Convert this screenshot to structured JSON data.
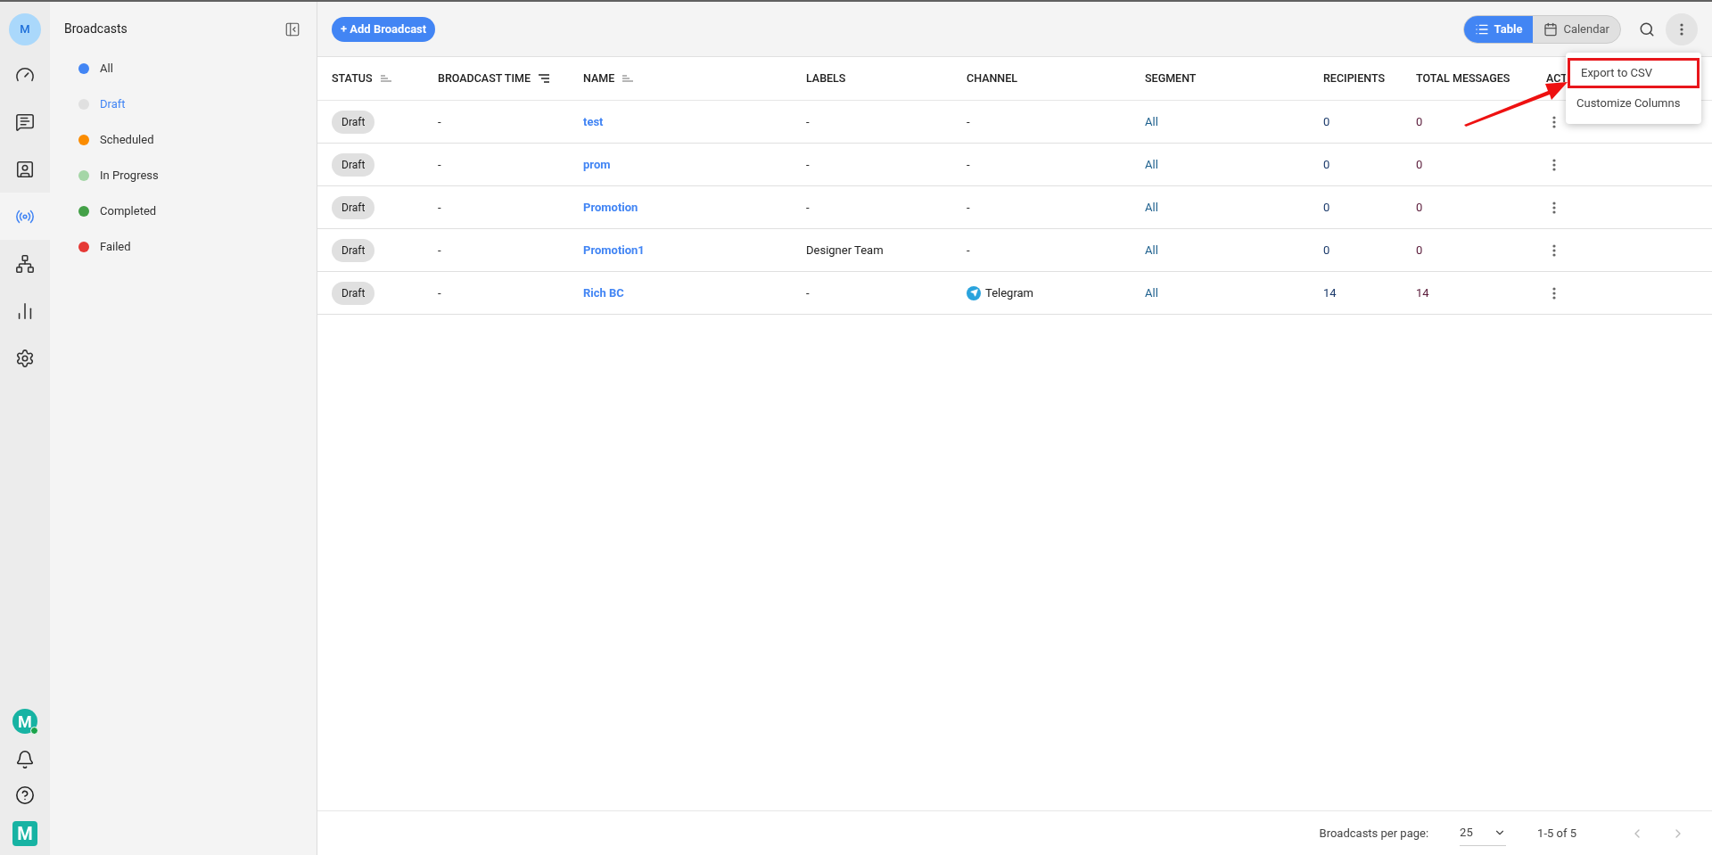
{
  "rail": {
    "avatar": "M",
    "items": [
      {
        "selected": false
      },
      {
        "selected": false
      },
      {
        "selected": false
      },
      {
        "selected": true
      },
      {
        "selected": false
      },
      {
        "selected": false
      },
      {
        "selected": false
      }
    ],
    "workspace_logo": "M",
    "brand_logo": "M"
  },
  "sidebar": {
    "title": "Broadcasts",
    "items": [
      {
        "label": "All",
        "color": "#4285f4",
        "selected": false
      },
      {
        "label": "Draft",
        "color": "#e0e0e0",
        "selected": true
      },
      {
        "label": "Scheduled",
        "color": "#fb8c00",
        "selected": false
      },
      {
        "label": "In Progress",
        "color": "#a5d6a7",
        "selected": false
      },
      {
        "label": "Completed",
        "color": "#43a047",
        "selected": false
      },
      {
        "label": "Failed",
        "color": "#e53935",
        "selected": false
      }
    ]
  },
  "toolbar": {
    "add_button": "+ Add Broadcast",
    "views": [
      {
        "label": "Table",
        "selected": true
      },
      {
        "label": "Calendar",
        "selected": false
      }
    ]
  },
  "table": {
    "columns": [
      {
        "label": "STATUS",
        "kind": "sortable"
      },
      {
        "label": "BROADCAST TIME",
        "kind": "sorted"
      },
      {
        "label": "NAME",
        "kind": "sortable"
      },
      {
        "label": "LABELS",
        "kind": "plain"
      },
      {
        "label": "CHANNEL",
        "kind": "plain"
      },
      {
        "label": "SEGMENT",
        "kind": "plain"
      },
      {
        "label": "RECIPIENTS",
        "kind": "plain"
      },
      {
        "label": "TOTAL MESSAGES",
        "kind": "plain"
      },
      {
        "label": "ACT",
        "kind": "plain"
      }
    ],
    "rows": [
      {
        "status": "Draft",
        "time": "-",
        "name": "test",
        "labels": "-",
        "channel": "-",
        "channel_icon": false,
        "segment": "All",
        "recipients": "0",
        "total": "0"
      },
      {
        "status": "Draft",
        "time": "-",
        "name": "prom",
        "labels": "-",
        "channel": "-",
        "channel_icon": false,
        "segment": "All",
        "recipients": "0",
        "total": "0"
      },
      {
        "status": "Draft",
        "time": "-",
        "name": "Promotion",
        "labels": "-",
        "channel": "-",
        "channel_icon": false,
        "segment": "All",
        "recipients": "0",
        "total": "0"
      },
      {
        "status": "Draft",
        "time": "-",
        "name": "Promotion1",
        "labels": "Designer Team",
        "channel": "-",
        "channel_icon": false,
        "segment": "All",
        "recipients": "0",
        "total": "0"
      },
      {
        "status": "Draft",
        "time": "-",
        "name": "Rich BC",
        "labels": "-",
        "channel": "Telegram",
        "channel_icon": true,
        "segment": "All",
        "recipients": "14",
        "total": "14"
      }
    ]
  },
  "menu": {
    "items": [
      {
        "label": "Export to CSV",
        "highlighted": true
      },
      {
        "label": "Customize Columns",
        "highlighted": false
      }
    ]
  },
  "footer": {
    "per_page_label": "Broadcasts per page:",
    "per_page": "25",
    "range": "1-5 of 5"
  }
}
